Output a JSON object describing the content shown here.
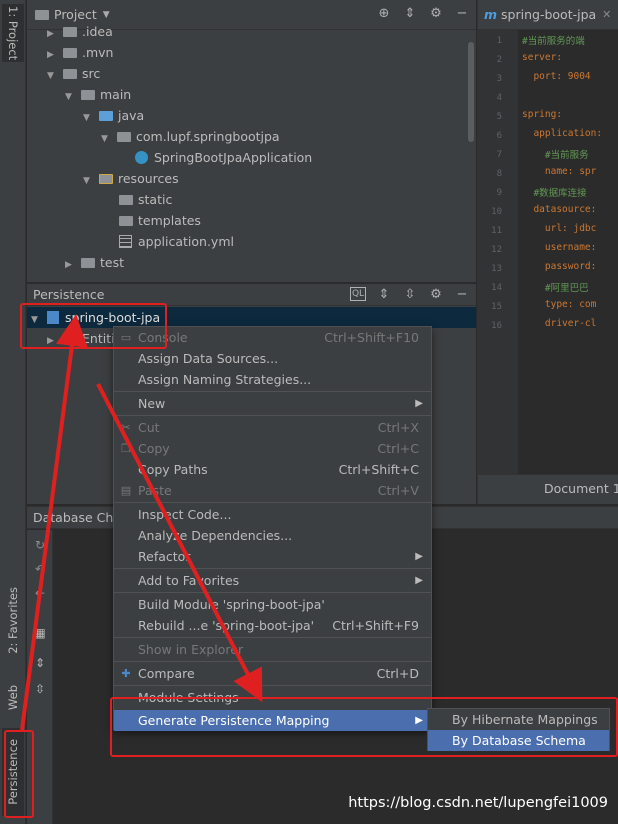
{
  "tool_strip": {
    "project_tab": "1: Project",
    "favorites_tab": "2: Favorites",
    "web_tab": "Web",
    "persistence_tab": "Persistence"
  },
  "project_panel": {
    "title": "Project",
    "tree": [
      {
        "label": ".idea",
        "icon": "folder-icon"
      },
      {
        "label": ".mvn",
        "icon": "folder-icon"
      },
      {
        "label": "src",
        "icon": "folder-icon"
      },
      {
        "label": "main",
        "icon": "folder-icon"
      },
      {
        "label": "java",
        "icon": "source-folder-icon"
      },
      {
        "label": "com.lupf.springbootjpa",
        "icon": "package-icon"
      },
      {
        "label": "SpringBootJpaApplication",
        "icon": "spring-class-icon"
      },
      {
        "label": "resources",
        "icon": "resources-folder-icon"
      },
      {
        "label": "static",
        "icon": "folder-icon"
      },
      {
        "label": "templates",
        "icon": "folder-icon"
      },
      {
        "label": "application.yml",
        "icon": "yml-file-icon"
      },
      {
        "label": "test",
        "icon": "folder-icon"
      }
    ]
  },
  "persistence_panel": {
    "title": "Persistence",
    "root_item": "spring-boot-jpa",
    "child_item": "Entiti"
  },
  "editor": {
    "tab_label": "spring-boot-jpa",
    "line_numbers": [
      "1",
      "2",
      "3",
      "4",
      "5",
      "6",
      "7",
      "8",
      "9",
      "10",
      "11",
      "12",
      "13",
      "14",
      "15",
      "16"
    ],
    "lines": [
      "#当前服务的端",
      "server:",
      "  port: 9004",
      "",
      "spring:",
      "  application:",
      "    #当前服务",
      "    name: spr",
      "  #数据库连接",
      "  datasource:",
      "    url: jdbc",
      "    username:",
      "    password:",
      "    #阿里巴巴",
      "    type: com",
      "    driver-cl"
    ],
    "status": "Document 1/"
  },
  "db_panel": {
    "title": "Database Cha"
  },
  "context_menu": {
    "items": [
      {
        "label": "Console",
        "shortcut": "Ctrl+Shift+F10",
        "disabled": true
      },
      {
        "label": "Assign Data Sources...",
        "shortcut": ""
      },
      {
        "label": "Assign Naming Strategies...",
        "shortcut": ""
      },
      {
        "label": "New",
        "shortcut": "",
        "submenu": true
      },
      {
        "label": "Cut",
        "shortcut": "Ctrl+X",
        "disabled": true
      },
      {
        "label": "Copy",
        "shortcut": "Ctrl+C",
        "disabled": true
      },
      {
        "label": "Copy Paths",
        "shortcut": "Ctrl+Shift+C"
      },
      {
        "label": "Paste",
        "shortcut": "Ctrl+V",
        "disabled": true
      },
      {
        "label": "Inspect Code...",
        "shortcut": ""
      },
      {
        "label": "Analyze Dependencies...",
        "shortcut": ""
      },
      {
        "label": "Refactor",
        "shortcut": "",
        "submenu": true
      },
      {
        "label": "Add to Favorites",
        "shortcut": "",
        "submenu": true
      },
      {
        "label": "Build Module 'spring-boot-jpa'",
        "shortcut": ""
      },
      {
        "label": "Rebuild ...e 'spring-boot-jpa'",
        "shortcut": "Ctrl+Shift+F9"
      },
      {
        "label": "Show in Explorer",
        "shortcut": "",
        "disabled": true
      },
      {
        "label": "Compare",
        "shortcut": "Ctrl+D"
      },
      {
        "label": "Module Settings",
        "shortcut": ""
      },
      {
        "label": "Generate Persistence Mapping",
        "shortcut": "",
        "submenu": true,
        "selected": true
      }
    ]
  },
  "submenu": {
    "items": [
      {
        "label": "By Hibernate Mappings"
      },
      {
        "label": "By Database Schema",
        "selected": true
      }
    ]
  },
  "watermark": "https://blog.csdn.net/lupengfei1009",
  "colors": {
    "selection": "#4b6eaf",
    "annotation_red": "#e02020"
  }
}
